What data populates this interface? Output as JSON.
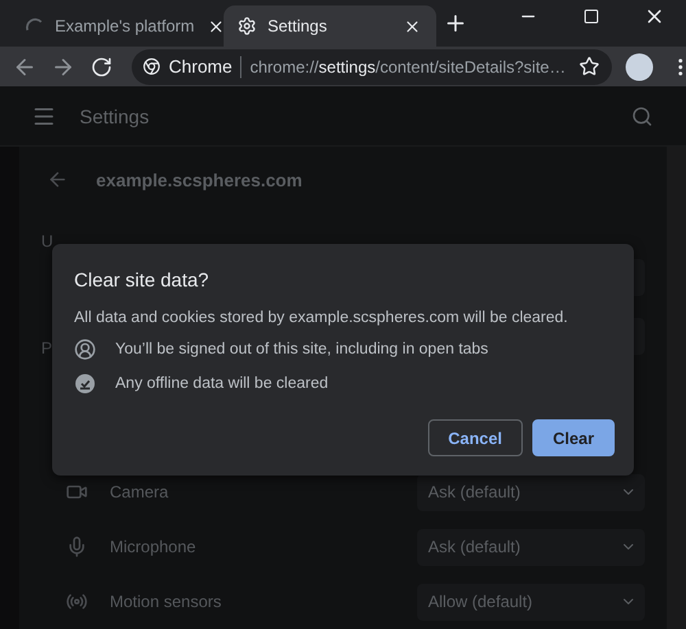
{
  "tabs": [
    {
      "title": "Example's platform",
      "selected": false,
      "kind": "loading"
    },
    {
      "title": "Settings",
      "selected": true,
      "kind": "settings"
    }
  ],
  "omnibox": {
    "chip": "Chrome",
    "url": "chrome://**settings**/content/siteDetails?site…"
  },
  "header": {
    "title": "Settings"
  },
  "page": {
    "site": "example.scspheres.com",
    "sections": [
      "U",
      "P"
    ],
    "permissions": [
      {
        "name": "Camera",
        "value": "Ask (default)",
        "kind": "camera"
      },
      {
        "name": "Microphone",
        "value": "Ask (default)",
        "kind": "microphone"
      },
      {
        "name": "Motion sensors",
        "value": "Allow (default)",
        "kind": "motion"
      }
    ]
  },
  "dialog": {
    "title": "Clear site data?",
    "message": "All data and cookies stored by example.scspheres.com will be cleared.",
    "items": [
      {
        "text": "You’ll be signed out of this site, including in open tabs",
        "kind": "account"
      },
      {
        "text": "Any offline data will be cleared",
        "kind": "offline"
      }
    ],
    "buttons": [
      {
        "label": "Cancel",
        "kind": "secondary"
      },
      {
        "label": "Clear",
        "kind": "primary"
      }
    ]
  }
}
